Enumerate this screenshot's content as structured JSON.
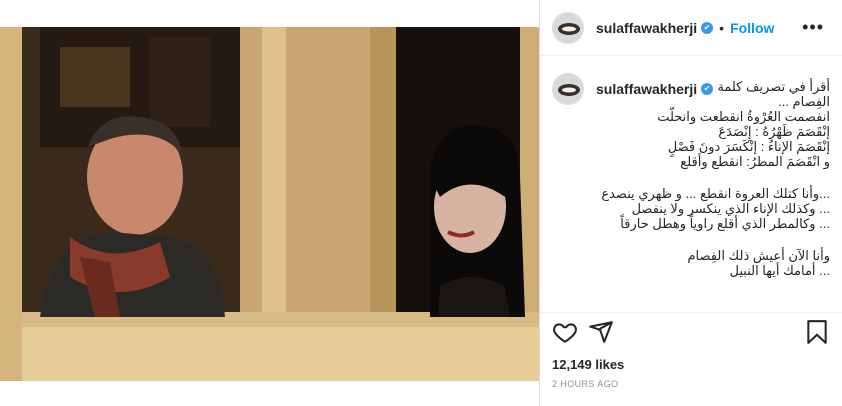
{
  "post": {
    "username": "sulaffawakherji",
    "verified_symbol": "✔",
    "separator": "•",
    "follow_label": "Follow",
    "more_symbol": "•••",
    "likes": "12,149 likes",
    "time": "2 HOURS AGO"
  },
  "caption": {
    "lines": [
      "أقرأ في تصريف كلمة",
      "الفِصام ...",
      "انفصمت العُرْوةُ انقطعت وانحلّت",
      "إنْقَصَمَ ظَهْرُهُ : إِنْصَدَعَ",
      "إنْقَصَمَ الإناءُ : إنْكَسَرَ دونَ فَصْلٍ",
      "و انْقَصَمَ المطرُ: انقطع وأقلع",
      "",
      "...وأنا كتلك العروة انقطع ... و ظهري ينصدع",
      "... وكذلك الإناء الذي ينكسر ولا ينفصل",
      "... وكالمطر الذي أقلع راوياً وهطل حارقاً",
      "",
      "وأنا الآن أعيش ذلك الفِصام",
      "... أمامك أيها النبيل"
    ]
  },
  "icons": {
    "like": "heart-icon",
    "share": "paper-plane-icon",
    "save": "bookmark-icon",
    "verified": "verified-badge-icon",
    "more": "more-options-icon"
  },
  "colors": {
    "follow": "#0095f6",
    "verified": "#3897f0",
    "text": "#262626",
    "muted": "#8e8e8e"
  }
}
